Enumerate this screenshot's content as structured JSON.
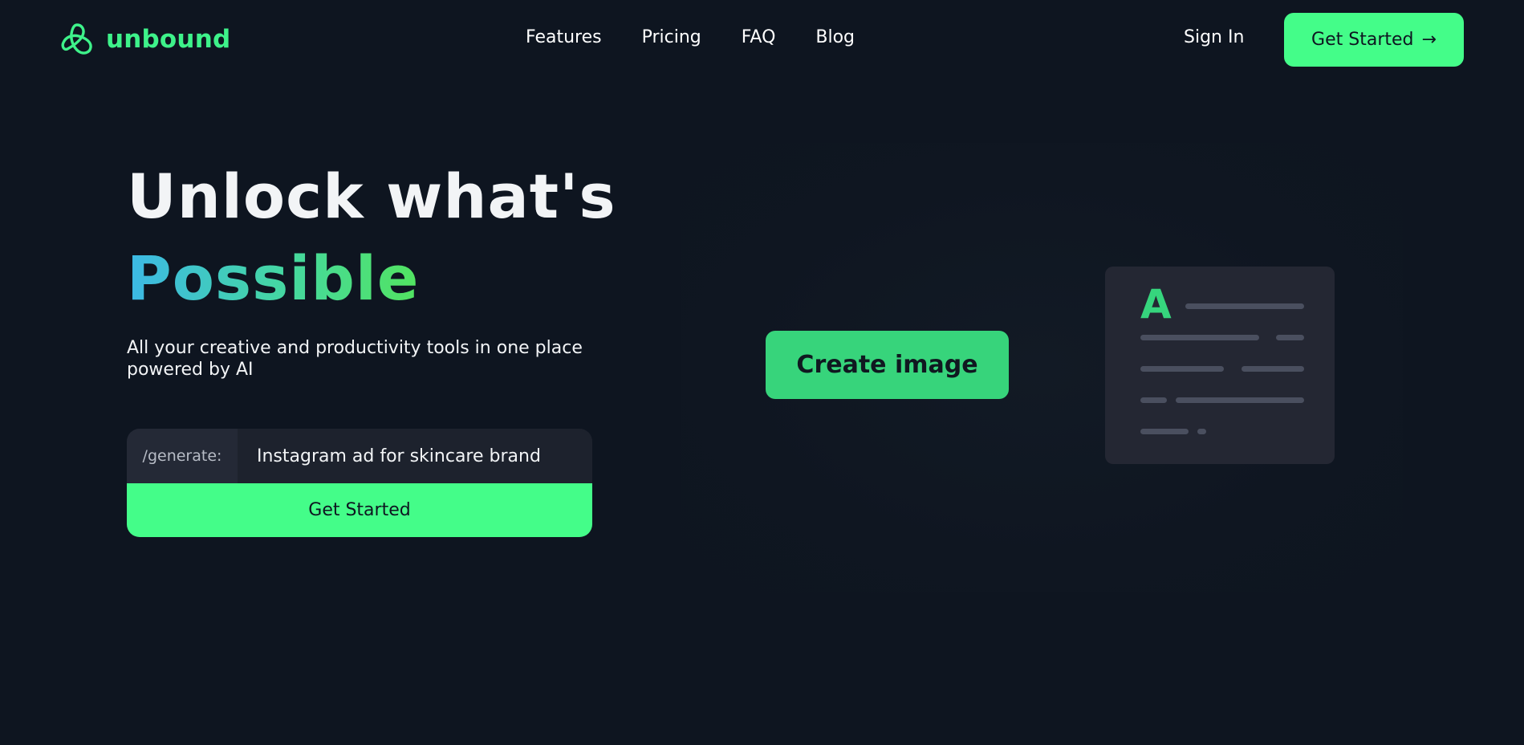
{
  "brand": {
    "name": "unbound",
    "accent": "#44fd89",
    "logo_icon": "trefoil-knot-icon"
  },
  "nav": {
    "items": [
      "Features",
      "Pricing",
      "FAQ",
      "Blog"
    ]
  },
  "header": {
    "sign_in": "Sign In",
    "cta": "Get Started",
    "cta_icon": "→"
  },
  "hero": {
    "line1": "Unlock what's",
    "line2": "Possible",
    "subtitle": "All your creative and productivity tools in one place powered by AI"
  },
  "prompt": {
    "prefix": "/generate:",
    "value": "Instagram ad for skincare brand",
    "button": "Get Started"
  },
  "illustration": {
    "create_button": "Create image",
    "doc_letter": "A"
  }
}
